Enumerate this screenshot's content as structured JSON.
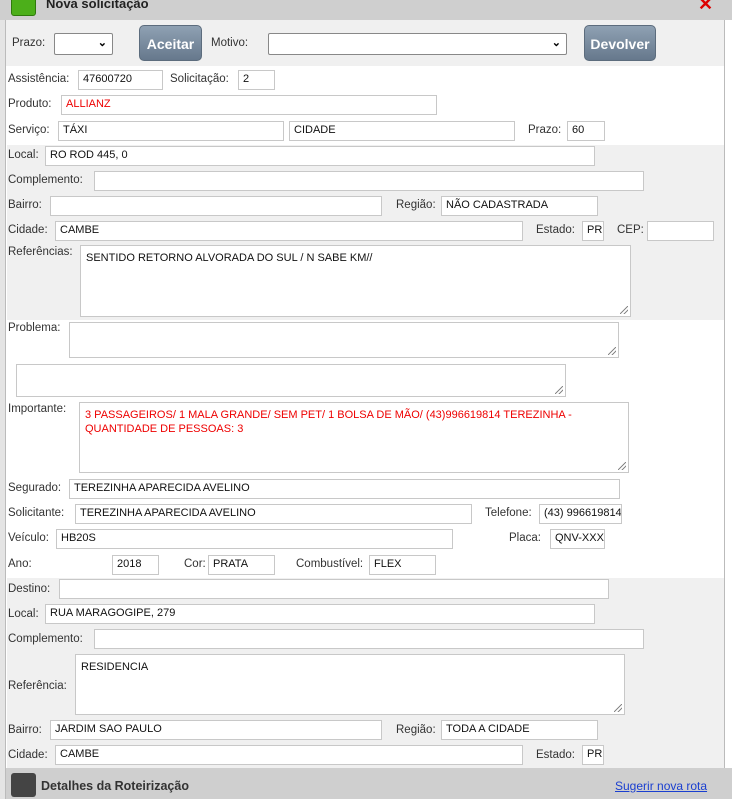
{
  "window": {
    "title": "Nova solicitação",
    "close_icon": "close-x-icon",
    "app_icon": "map-icon"
  },
  "toolbar": {
    "prazo_label": "Prazo:",
    "prazo_value": "",
    "accept_label": "Aceitar",
    "motivo_label": "Motivo:",
    "motivo_value": "",
    "return_label": "Devolver"
  },
  "form": {
    "assistencia_label": "Assistência:",
    "assistencia": "47600720",
    "solicitacao_label": "Solicitação:",
    "solicitacao": "2",
    "produto_label": "Produto:",
    "produto": "ALLIANZ",
    "servico_label": "Serviço:",
    "servico": "TÁXI",
    "servico2": "CIDADE",
    "prazo_label": "Prazo:",
    "prazo": "60",
    "local_label": "Local:",
    "local": "RO ROD 445, 0",
    "complemento_label": "Complemento:",
    "complemento": "",
    "bairro_label": "Bairro:",
    "bairro": "",
    "regiao_label": "Região:",
    "regiao": "NÃO CADASTRADA",
    "cidade_label": "Cidade:",
    "cidade": "CAMBE",
    "estado_label": "Estado:",
    "estado": "PR",
    "cep_label": "CEP:",
    "cep": "",
    "referencias_label": "Referências:",
    "referencias": "SENTIDO RETORNO ALVORADA DO SUL / N SABE KM//",
    "problema_label": "Problema:",
    "problema": "",
    "extra": "",
    "importante_label": "Importante:",
    "importante": "3 PASSAGEIROS/ 1 MALA GRANDE/ SEM PET/ 1 BOLSA DE MÃO/ (43)996619814 TEREZINHA - QUANTIDADE DE PESSOAS: 3",
    "segurado_label": "Segurado:",
    "segurado": "TEREZINHA APARECIDA AVELINO",
    "solicitante_label": "Solicitante:",
    "solicitante": "TEREZINHA APARECIDA AVELINO",
    "telefone_label": "Telefone:",
    "telefone": "(43) 996619814",
    "veiculo_label": "Veículo:",
    "veiculo": "HB20S",
    "placa_label": "Placa:",
    "placa": "QNV-XXXX",
    "ano_label": "Ano:",
    "ano": "2018",
    "cor_label": "Cor:",
    "cor": "PRATA",
    "combustivel_label": "Combustível:",
    "combustivel": "FLEX"
  },
  "destino": {
    "destino_label": "Destino:",
    "destino": "",
    "local_label": "Local:",
    "local": "RUA MARAGOGIPE, 279",
    "complemento_label": "Complemento:",
    "complemento": "",
    "referencia_label": "Referência:",
    "referencia": "RESIDENCIA",
    "bairro_label": "Bairro:",
    "bairro": "JARDIM SAO PAULO",
    "regiao_label": "Região:",
    "regiao": "TODA A CIDADE",
    "cidade_label": "Cidade:",
    "cidade": "CAMBE",
    "estado_label": "Estado:",
    "estado": "PR"
  },
  "footer": {
    "title": "Detalhes da Roteirização",
    "link": "Sugerir nova rota",
    "icon": "globe-icon"
  },
  "colors": {
    "accent_red": "#e00000",
    "button": "#6f8196",
    "link": "#1a3fd0"
  }
}
